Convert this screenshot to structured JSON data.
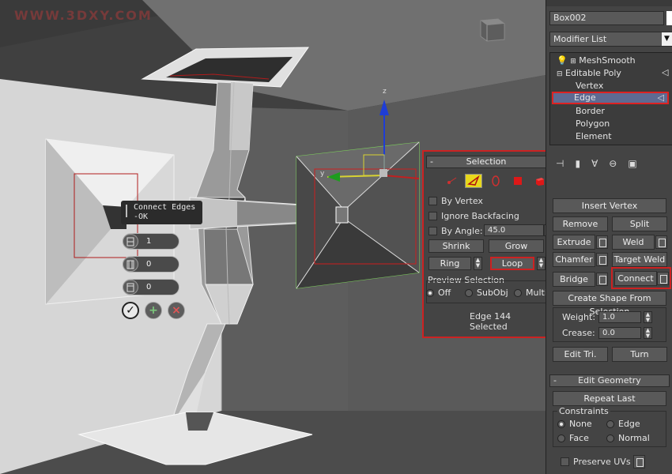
{
  "watermark": "WWW.3DXY.COM",
  "viewport": {
    "caddy": {
      "title": "Connect Edges",
      "subtitle": "-OK",
      "segments_value": "1",
      "pinch_value": "0",
      "slide_value": "0"
    }
  },
  "selection_panel": {
    "title": "Selection",
    "minus": "-",
    "by_vertex": "By Vertex",
    "ignore_backfacing": "Ignore Backfacing",
    "by_angle": "By Angle:",
    "angle_value": "45.0",
    "shrink": "Shrink",
    "grow": "Grow",
    "ring": "Ring",
    "loop": "Loop",
    "preview_label": "Preview Selection",
    "preview_options": [
      "Off",
      "SubObj",
      "Multi"
    ],
    "preview_selected": "Off",
    "status": "Edge 144 Selected"
  },
  "command_panel": {
    "object_name": "Box002",
    "modifier_list": "Modifier List",
    "stack": [
      "MeshSmooth",
      "Editable Poly",
      "Vertex",
      "Edge",
      "Border",
      "Polygon",
      "Element"
    ],
    "stack_selected": "Edge",
    "edit_edges": {
      "insert_vertex": "Insert Vertex",
      "remove": "Remove",
      "split": "Split",
      "extrude": "Extrude",
      "weld": "Weld",
      "chamfer": "Chamfer",
      "target_weld": "Target Weld",
      "bridge": "Bridge",
      "connect": "Connect",
      "create_shape": "Create Shape From Selection",
      "weight_label": "Weight:",
      "weight_value": "1.0",
      "crease_label": "Crease:",
      "crease_value": "0.0",
      "edit_tri": "Edit Tri.",
      "turn": "Turn"
    },
    "edit_geometry": {
      "title": "Edit Geometry",
      "minus": "-",
      "repeat_last": "Repeat Last",
      "constraints": "Constraints",
      "options": [
        "None",
        "Edge",
        "Face",
        "Normal"
      ],
      "selected": "None",
      "preserve_uvs": "Preserve UVs"
    }
  },
  "colors": {
    "highlight": "#dd2222",
    "active_selection_mode": "#e8d81c",
    "stack_selected": "#5e6a92"
  }
}
